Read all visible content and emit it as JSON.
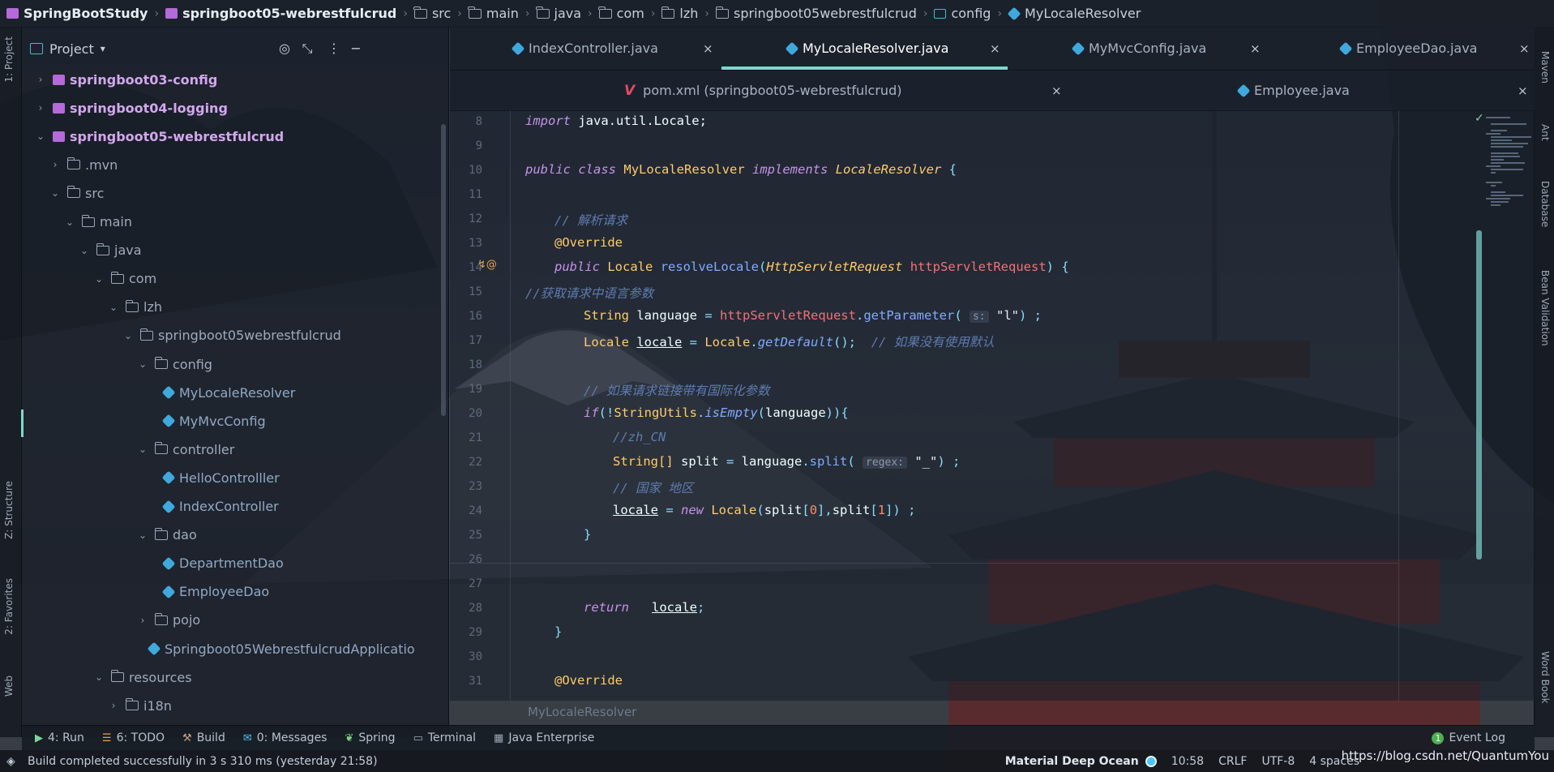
{
  "breadcrumb": [
    {
      "label": "SpringBootStudy",
      "icon": "module-icon",
      "bold": true
    },
    {
      "label": "springboot05-webrestfulcrud",
      "icon": "module-icon",
      "bold": true
    },
    {
      "label": "src",
      "icon": "source-folder-icon"
    },
    {
      "label": "main",
      "icon": "folder-icon"
    },
    {
      "label": "java",
      "icon": "folder-icon"
    },
    {
      "label": "com",
      "icon": "folder-icon"
    },
    {
      "label": "lzh",
      "icon": "folder-icon"
    },
    {
      "label": "springboot05webrestfulcrud",
      "icon": "folder-icon"
    },
    {
      "label": "config",
      "icon": "config-package-icon"
    },
    {
      "label": "MyLocaleResolver",
      "icon": "class-icon"
    }
  ],
  "left_stripe": {
    "project": "1: Project",
    "structure": "Z: Structure",
    "favorites": "2: Favorites",
    "web": "Web"
  },
  "right_stripe": {
    "maven": "Maven",
    "ant": "Ant",
    "database": "Database",
    "bean": "Bean Validation",
    "wordbook": "Word Book"
  },
  "project_panel": {
    "title": "Project",
    "tree": [
      {
        "label": "springboot03-config",
        "type": "module",
        "arrow": "›",
        "collapsed": true
      },
      {
        "label": "springboot04-logging",
        "type": "module",
        "arrow": "›",
        "collapsed": true
      },
      {
        "label": "springboot05-webrestfulcrud",
        "type": "module",
        "arrow": "⌄"
      },
      {
        "label": ".mvn",
        "type": "folder",
        "arrow": "›"
      },
      {
        "label": "src",
        "type": "folder",
        "arrow": "⌄"
      },
      {
        "label": "main",
        "type": "folder",
        "arrow": "⌄"
      },
      {
        "label": "java",
        "type": "folder",
        "arrow": "⌄"
      },
      {
        "label": "com",
        "type": "folder",
        "arrow": "⌄"
      },
      {
        "label": "lzh",
        "type": "folder",
        "arrow": "⌄"
      },
      {
        "label": "springboot05webrestfulcrud",
        "type": "folder",
        "arrow": "⌄"
      },
      {
        "label": "config",
        "type": "folder",
        "arrow": "⌄"
      },
      {
        "label": "MyLocaleResolver",
        "type": "class",
        "arrow": ""
      },
      {
        "label": "MyMvcConfig",
        "type": "class",
        "arrow": ""
      },
      {
        "label": "controller",
        "type": "folder",
        "arrow": "⌄"
      },
      {
        "label": "HelloControlller",
        "type": "class",
        "arrow": ""
      },
      {
        "label": "IndexController",
        "type": "class",
        "arrow": ""
      },
      {
        "label": "dao",
        "type": "folder",
        "arrow": "⌄"
      },
      {
        "label": "DepartmentDao",
        "type": "class",
        "arrow": ""
      },
      {
        "label": "EmployeeDao",
        "type": "class",
        "arrow": ""
      },
      {
        "label": "pojo",
        "type": "folder",
        "arrow": "›"
      },
      {
        "label": "Springboot05WebrestfulcrudApplicatio",
        "type": "class",
        "arrow": ""
      },
      {
        "label": "resources",
        "type": "folder",
        "arrow": "⌄"
      },
      {
        "label": "i18n",
        "type": "folder",
        "arrow": "›"
      }
    ]
  },
  "tabs_row1": [
    {
      "label": "IndexController.java",
      "active": false
    },
    {
      "label": "MyLocaleResolver.java",
      "active": true
    },
    {
      "label": "MyMvcConfig.java",
      "active": false
    },
    {
      "label": "EmployeeDao.java",
      "active": false
    }
  ],
  "tabs_row2": [
    {
      "label": "pom.xml (springboot05-webrestfulcrud)",
      "icon": "maven-icon"
    },
    {
      "label": "Employee.java",
      "icon": "class-icon"
    }
  ],
  "close_glyph": "×",
  "editor": {
    "line_numbers": [
      "8",
      "9",
      "10",
      "11",
      "12",
      "13",
      "14",
      "15",
      "16",
      "17",
      "18",
      "19",
      "20",
      "21",
      "22",
      "23",
      "24",
      "25",
      "26",
      "27",
      "28",
      "29",
      "30",
      "31"
    ],
    "footer_breadcrumb": "MyLocaleResolver",
    "code": {
      "l8_import": "import",
      "l8_rest": " java.util.Locale;",
      "public": "public",
      "class": "class",
      "class_name": "MyLocaleResolver",
      "implements": "implements",
      "iface": "LocaleResolver",
      "brace_open": " {",
      "cmt_parse": "// 解析请求",
      "override": "@Override",
      "locale_type": "Locale",
      "resolve": "resolveLocale",
      "req_type": "HttpServletRequest",
      "req_param": "httpServletRequest",
      "sig_end": ") {",
      "cmt_get": "//获取请求中语言参数",
      "string": "String",
      "language": "language",
      "eq": " = ",
      "getParameter": "getParameter",
      "hint_s": "s:",
      "str_l": "\"l\"",
      "semi": ") ;",
      "locale_var": "locale",
      "locale_cls": "Locale",
      "getDefault": "getDefault",
      "cmt_default": "// 如果没有使用默认",
      "cmt_intl": "// 如果请求链接带有国际化参数",
      "if": "if",
      "string_utils": "StringUtils",
      "isEmpty": "isEmpty",
      "cmt_zh": "//zh_CN",
      "string_arr": "String[]",
      "split_var": "split",
      "split_fn": "split",
      "hint_regex": "regex:",
      "str_underscore": "\"_\"",
      "cmt_country": "// 国家 地区",
      "new": "new",
      "idx0": "0",
      "idx1": "1",
      "close_brace": "}",
      "return": "return"
    }
  },
  "toolbar": {
    "run": "4: Run",
    "todo": "6: TODO",
    "build": "Build",
    "messages": "0: Messages",
    "spring": "Spring",
    "terminal": "Terminal",
    "java_enterprise": "Java Enterprise",
    "event_log": "Event Log",
    "event_count": "1"
  },
  "statusbar": {
    "message": "Build completed successfully in 3 s 310 ms (yesterday 21:58)",
    "theme": "Material Deep Ocean",
    "position": "10:58",
    "line_sep": "CRLF",
    "encoding": "UTF-8",
    "indent": "4 spaces",
    "watermark": "https://blog.csdn.net/QuantumYou"
  },
  "colors": {
    "accent": "#7fd6d0",
    "keyword": "#c792ea",
    "class": "#ffcb6b",
    "function": "#82aaff",
    "comment": "#5f7bb0"
  }
}
